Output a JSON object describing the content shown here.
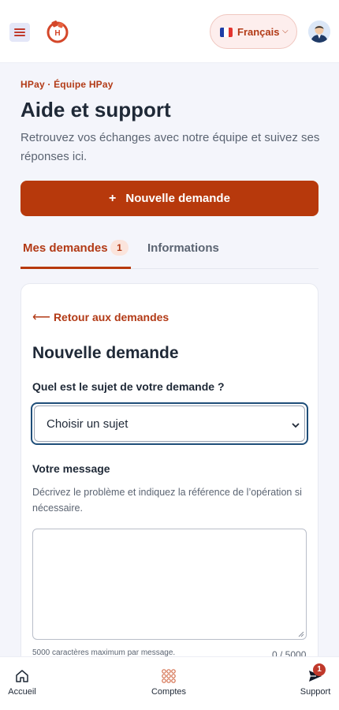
{
  "header": {
    "menu_icon": "hamburger-icon",
    "logo_icon": "hpay-logo-icon",
    "language_label": "Français",
    "language_flag": "flag-fr-icon",
    "language_chevron": "chevron-down-icon",
    "avatar_icon": "user-avatar-icon",
    "accent_color": "#b7390c"
  },
  "page": {
    "eyebrow": "HPay · Équipe HPay",
    "title": "Aide et support",
    "subtitle": "Retrouvez vos échanges avec notre équipe et suivez ses réponses ici.",
    "new_request_label": "Nouvelle demande",
    "new_request_icon": "+"
  },
  "tabs": {
    "my_requests_label": "Mes demandes",
    "my_requests_count": "1",
    "info_label": "Informations",
    "active": "Mes demandes"
  },
  "form": {
    "back_arrow": "⟵",
    "back_label": "Retour aux demandes",
    "title": "Nouvelle demande",
    "subject_label": "Quel est le sujet de votre demande ?",
    "subject_value": "Choisir un sujet",
    "message_label": "Votre message",
    "message_help": "Décrivez le problème et indiquez la référence de l’opération si nécessaire.",
    "message_value": "",
    "max_hint": "5000 caractères maximum par message.",
    "counter": "0 / 5000"
  },
  "bottom_nav": {
    "items": [
      {
        "label": "Accueil",
        "icon": "home-icon"
      },
      {
        "label": "Comptes",
        "icon": "accounts-grid-icon"
      },
      {
        "label": "Support",
        "icon": "send-icon",
        "badge": "1"
      }
    ]
  }
}
